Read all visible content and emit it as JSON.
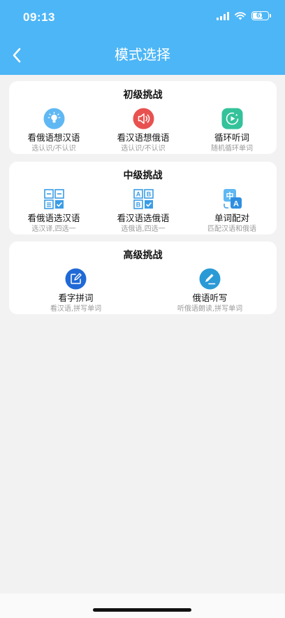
{
  "status": {
    "time": "09:13",
    "battery": "61"
  },
  "header": {
    "title": "模式选择"
  },
  "sections": [
    {
      "title": "初级挑战",
      "items": [
        {
          "label": "看俄语想汉语",
          "sub": "选认识/不认识",
          "icon": "lightbulb-icon"
        },
        {
          "label": "看汉语想俄语",
          "sub": "选认识/不认识",
          "icon": "speaker-icon"
        },
        {
          "label": "循环听词",
          "sub": "随机循环单词",
          "icon": "loop-play-icon"
        }
      ]
    },
    {
      "title": "中级挑战",
      "items": [
        {
          "label": "看俄语选汉语",
          "sub": "选汉译,四选一",
          "icon": "choice-grid-icon"
        },
        {
          "label": "看汉语选俄语",
          "sub": "选俄语,四选一",
          "icon": "abcd-choice-icon"
        },
        {
          "label": "单词配对",
          "sub": "匹配汉语和俄语",
          "icon": "translate-icon",
          "glyph1": "中",
          "glyph2": "A"
        }
      ]
    },
    {
      "title": "高级挑战",
      "items": [
        {
          "label": "看字拼词",
          "sub": "看汉语,拼写单词",
          "icon": "edit-icon"
        },
        {
          "label": "俄语听写",
          "sub": "听俄语朗读,拼写单词",
          "icon": "pen-write-icon"
        }
      ]
    }
  ],
  "colors": {
    "header": "#4db6f6",
    "card": "#ffffff",
    "background": "#f2f2f2"
  }
}
